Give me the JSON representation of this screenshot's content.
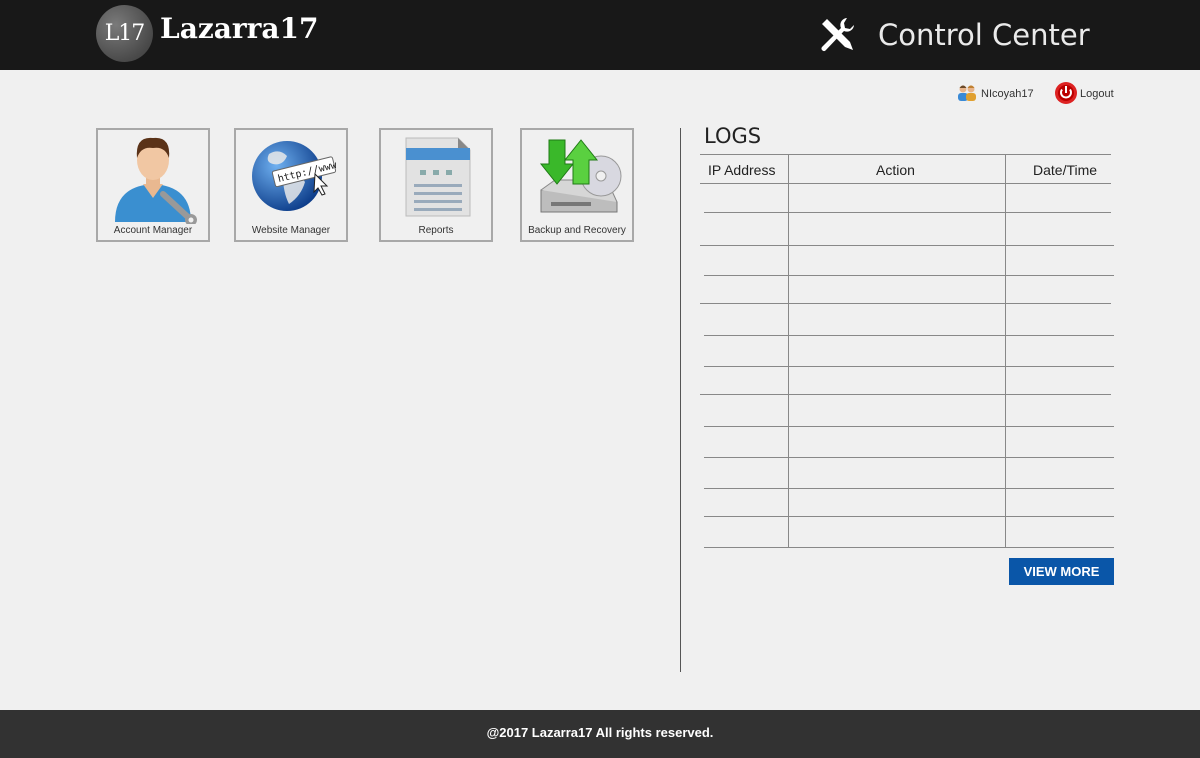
{
  "header": {
    "logo_badge": "L17",
    "brand": "Lazarra17",
    "title": "Control Center",
    "tools_icon": "wrench-screwdriver-icon"
  },
  "user": {
    "name": "NIcoyah17",
    "logout_label": "Logout",
    "user_icon": "users-icon",
    "logout_icon": "power-icon"
  },
  "tiles": [
    {
      "label": "Account Manager",
      "icon": "account-manager-icon"
    },
    {
      "label": "Website Manager",
      "icon": "globe-http-icon"
    },
    {
      "label": "Reports",
      "icon": "document-report-icon"
    },
    {
      "label": "Backup and Recovery",
      "icon": "backup-disk-icon"
    }
  ],
  "logs": {
    "title": "LOGS",
    "columns": [
      "IP Address",
      "Action",
      "Date/Time"
    ],
    "rows": [],
    "view_more_label": "VIEW MORE"
  },
  "footer": {
    "text": "@2017 Lazarra17 All rights  reserved."
  },
  "colors": {
    "header_bg": "#181818",
    "footer_bg": "#323232",
    "page_bg": "#f0f0f0",
    "button_blue": "#0a56a8"
  }
}
